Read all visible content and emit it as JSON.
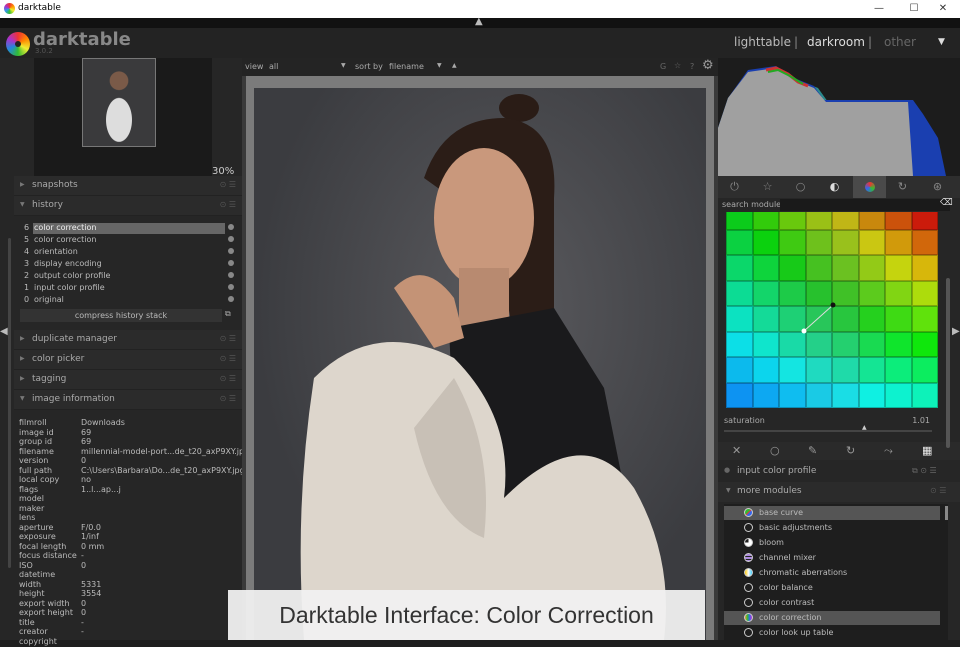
{
  "window": {
    "title": "darktable",
    "minimize": "—",
    "maximize": "☐",
    "close": "✕"
  },
  "app": {
    "name": "darktable",
    "version": "3.0.2"
  },
  "views": {
    "lighttable": "lighttable",
    "darkroom": "darkroom",
    "other": "other",
    "sep": "|"
  },
  "left": {
    "zoom": "30%",
    "sections": {
      "snapshots": "snapshots",
      "history": "history",
      "duplicate": "duplicate manager",
      "colorpicker": "color picker",
      "tagging": "tagging",
      "imageinfo": "image information"
    },
    "history": [
      {
        "n": "6",
        "label": "color correction"
      },
      {
        "n": "5",
        "label": "color correction"
      },
      {
        "n": "4",
        "label": "orientation"
      },
      {
        "n": "3",
        "label": "display encoding"
      },
      {
        "n": "2",
        "label": "output color profile"
      },
      {
        "n": "1",
        "label": "input color profile"
      },
      {
        "n": "0",
        "label": "original"
      }
    ],
    "compress": "compress history stack",
    "info": [
      [
        "filmroll",
        "Downloads"
      ],
      [
        "image id",
        "69"
      ],
      [
        "group id",
        "69"
      ],
      [
        "filename",
        "millennial-model-port...de_t20_axP9XY.jpg"
      ],
      [
        "version",
        "0"
      ],
      [
        "full path",
        "C:\\Users\\Barbara\\Do...de_t20_axP9XY.jpg"
      ],
      [
        "local copy",
        "no"
      ],
      [
        "flags",
        "1..l...ap...j"
      ],
      [
        "model",
        ""
      ],
      [
        "maker",
        ""
      ],
      [
        "lens",
        ""
      ],
      [
        "aperture",
        "F/0.0"
      ],
      [
        "exposure",
        "1/inf"
      ],
      [
        "focal length",
        "0 mm"
      ],
      [
        "focus distance",
        "-"
      ],
      [
        "ISO",
        "0"
      ],
      [
        "datetime",
        ""
      ],
      [
        "width",
        "5331"
      ],
      [
        "height",
        "3554"
      ],
      [
        "export width",
        "0"
      ],
      [
        "export height",
        "0"
      ],
      [
        "title",
        "-"
      ],
      [
        "creator",
        "-"
      ],
      [
        "copyright",
        ""
      ]
    ]
  },
  "center": {
    "view_label": "view",
    "view_value": "all",
    "sort_label": "sort by",
    "sort_value": "filename",
    "sort_dir": "▲",
    "g": "G",
    "star": "☆",
    "help": "?",
    "gear": "⚙"
  },
  "right": {
    "search_label": "search module",
    "saturation_label": "saturation",
    "saturation_value": "1.01",
    "input_profile": "input color profile",
    "more_modules": "more modules",
    "modules": [
      {
        "label": "base curve",
        "icon": "base-curve",
        "sel": true
      },
      {
        "label": "basic adjustments",
        "icon": "circle"
      },
      {
        "label": "bloom",
        "icon": "bloom"
      },
      {
        "label": "channel mixer",
        "icon": "channel-mixer"
      },
      {
        "label": "chromatic aberrations",
        "icon": "chromatic"
      },
      {
        "label": "color balance",
        "icon": "circle"
      },
      {
        "label": "color contrast",
        "icon": "circle"
      },
      {
        "label": "color correction",
        "icon": "color-correction",
        "sel": true
      },
      {
        "label": "color look up table",
        "icon": "circle"
      }
    ]
  },
  "caption": "Darktable Interface: Color Correction"
}
